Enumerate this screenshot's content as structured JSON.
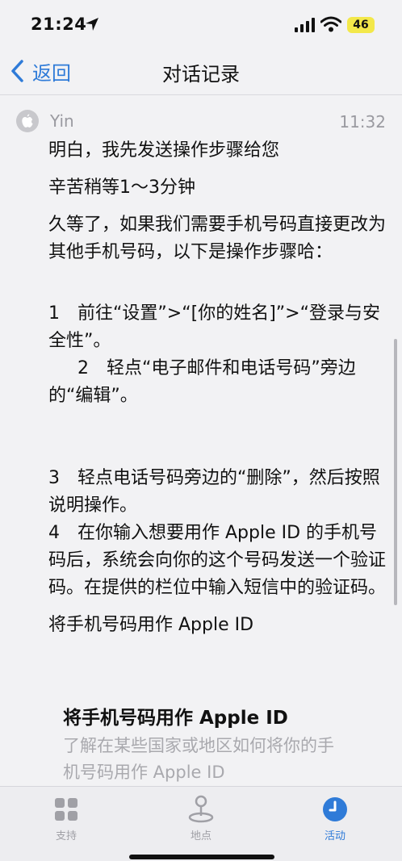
{
  "status_bar": {
    "time": "21:24",
    "battery": "46"
  },
  "nav": {
    "back_label": "返回",
    "title": "对话记录"
  },
  "message": {
    "sender": "Yin",
    "time": "11:32",
    "paragraphs": [
      "明白，我先发送操作步骤给您",
      "辛苦稍等1～3分钟",
      "久等了，如果我们需要手机号码直接更改为其他手机号码，以下是操作步骤哈：",
      "1　前往“设置”>“[你的姓名]”>“登录与安全性”。",
      "2　轻点“电子邮件和电话号码”旁边的“编辑”。",
      "3　轻点电话号码旁边的“删除”，然后按照说明操作。",
      "4　在你输入想要用作 Apple ID 的手机号码后，系统会向你的这个号码发送一个验证码。在提供的栏位中输入短信中的验证码。",
      "将手机号码用作 Apple ID"
    ]
  },
  "link_card": {
    "title": "将手机号码用作 Apple ID",
    "subtitle": "了解在某些国家或地区如何将你的手机号码用作 Apple ID"
  },
  "tabs": [
    {
      "label": "支持",
      "icon": "grid-icon"
    },
    {
      "label": "地点",
      "icon": "map-pin-icon"
    },
    {
      "label": "活动",
      "icon": "clock-icon"
    }
  ],
  "colors": {
    "accent": "#2f7bd8",
    "battery": "#f3e84a",
    "muted": "#a0a0a6"
  }
}
